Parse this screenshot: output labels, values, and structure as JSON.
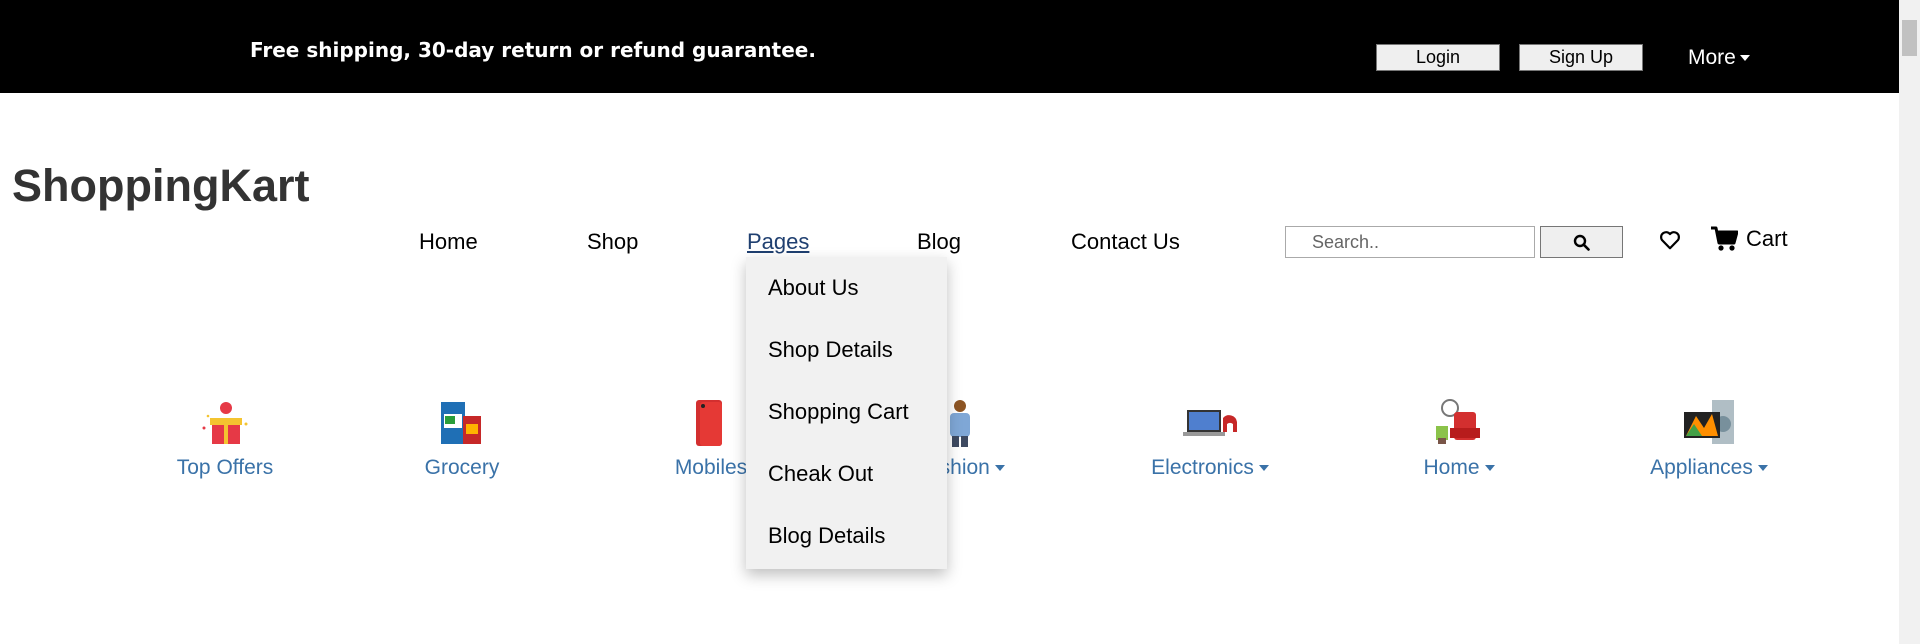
{
  "topbar": {
    "promo": "Free shipping, 30-day return or refund guarantee.",
    "login": "Login",
    "signup": "Sign Up",
    "more": "More"
  },
  "header": {
    "brand": "ShoppingKart",
    "nav": [
      "Home",
      "Shop",
      "Pages",
      "Blog",
      "Contact Us"
    ],
    "search_placeholder": "Search..",
    "cart": "Cart"
  },
  "dropdown": {
    "items": [
      "About Us",
      "Shop Details",
      "Shopping Cart",
      "Cheak Out",
      "Blog Details"
    ]
  },
  "categories": [
    {
      "label": "Top Offers"
    },
    {
      "label": "Grocery"
    },
    {
      "label": "Mobiles"
    },
    {
      "label": "Fashion"
    },
    {
      "label": "Electronics"
    },
    {
      "label": "Home"
    },
    {
      "label": "Appliances"
    }
  ],
  "colors": {
    "category_text": "#3a72a8",
    "active_nav": "#1f3f70"
  }
}
